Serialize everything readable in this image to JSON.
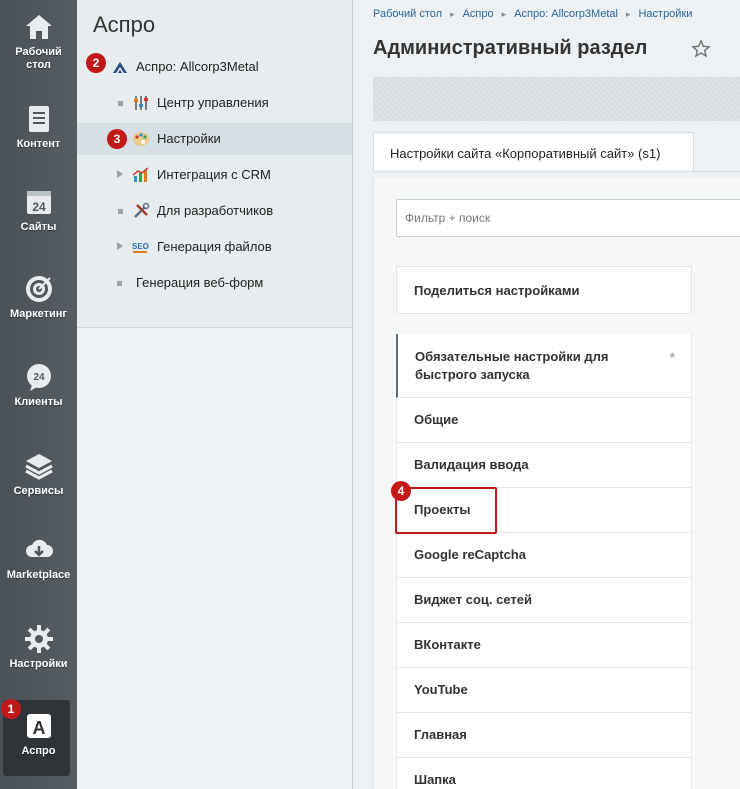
{
  "rail": {
    "items": [
      {
        "label": "Рабочий стол",
        "icon": "home-icon"
      },
      {
        "label": "Контент",
        "icon": "document-icon"
      },
      {
        "label": "Сайты",
        "icon": "calendar-24-icon"
      },
      {
        "label": "Маркетинг",
        "icon": "target-icon"
      },
      {
        "label": "Клиенты",
        "icon": "chat-24-icon"
      },
      {
        "label": "Сервисы",
        "icon": "layers-icon"
      },
      {
        "label": "Marketplace",
        "icon": "cloud-download-icon"
      },
      {
        "label": "Настройки",
        "icon": "gear-icon"
      },
      {
        "label": "Аспро",
        "icon": "aspro-a-icon"
      }
    ],
    "badge": "1"
  },
  "menu": {
    "title": "Аспро",
    "items": [
      {
        "label": "Аспро: Allcorp3Metal",
        "badge": "2"
      },
      {
        "label": "Центр управления"
      },
      {
        "label": "Настройки",
        "badge": "3"
      },
      {
        "label": "Интеграция с CRM"
      },
      {
        "label": "Для разработчиков"
      },
      {
        "label": "Генерация файлов"
      },
      {
        "label": "Генерация веб-форм"
      }
    ]
  },
  "breadcrumbs": [
    "Рабочий стол",
    "Аспро",
    "Аспро: Allcorp3Metal",
    "Настройки"
  ],
  "page": {
    "title": "Административный раздел",
    "tab": "Настройки сайта «Корпоративный сайт» (s1)",
    "filter_placeholder": "Фильтр + поиск",
    "share": "Поделиться настройками",
    "sections": [
      "Обязательные настройки для быстрого запуска",
      "Общие",
      "Валидация ввода",
      "Проекты",
      "Google reCaptcha",
      "Виджет соц. сетей",
      "ВКонтакте",
      "YouTube",
      "Главная",
      "Шапка"
    ],
    "highlight_badge": "4",
    "required_mark": "*"
  },
  "colors": {
    "badge": "#c31818",
    "link": "#2a6496",
    "rail": "#50575d"
  }
}
